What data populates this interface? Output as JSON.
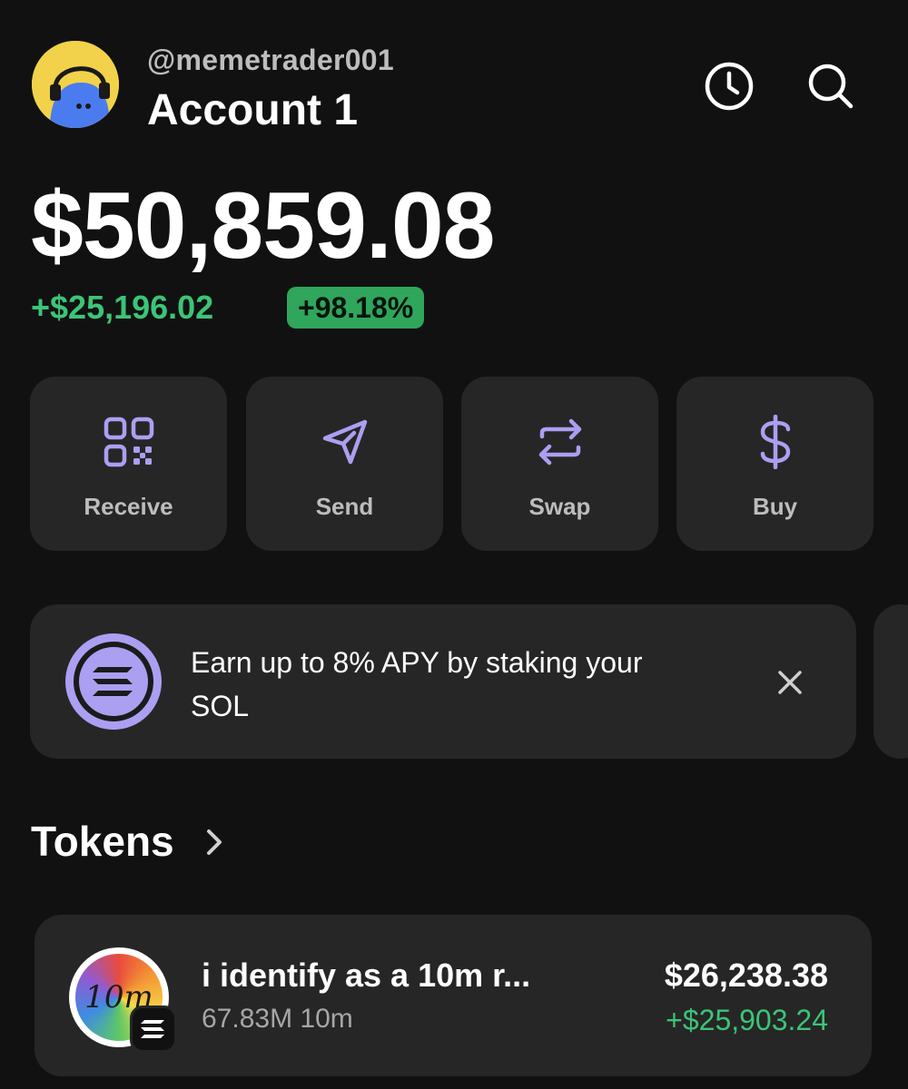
{
  "header": {
    "username": "@memetrader001",
    "account_name": "Account 1",
    "history_icon": "clock-icon",
    "search_icon": "search-icon",
    "avatar_icon": "avatar-ghost-headphones"
  },
  "balance": {
    "total": "$50,859.08",
    "change": "+$25,196.02",
    "change_percent": "+98.18%"
  },
  "actions": [
    {
      "label": "Receive",
      "icon": "qr-code-icon"
    },
    {
      "label": "Send",
      "icon": "paper-plane-icon"
    },
    {
      "label": "Swap",
      "icon": "swap-arrows-icon"
    },
    {
      "label": "Buy",
      "icon": "dollar-icon"
    }
  ],
  "promo": {
    "text": "Earn up to 8% APY by staking your SOL",
    "icon": "solana-icon",
    "close_icon": "close-icon"
  },
  "tokens": {
    "title": "Tokens",
    "items": [
      {
        "name": "i identify as a 10m r...",
        "amount": "67.83M 10m",
        "value": "$26,238.38",
        "change": "+$25,903.24",
        "logo_text": "10m"
      }
    ]
  },
  "colors": {
    "background": "#111111",
    "card": "#262626",
    "accent_purple": "#ab9ff2",
    "positive_green": "#3cc477"
  }
}
